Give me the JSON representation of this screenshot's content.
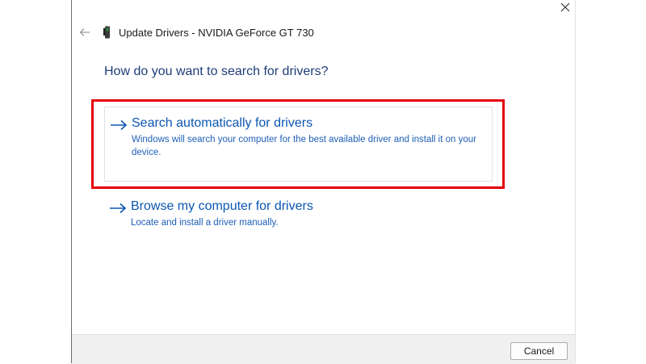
{
  "window": {
    "title": "Update Drivers - NVIDIA GeForce GT 730",
    "icons": {
      "close": "close-icon",
      "back": "arrow-left-icon",
      "device": "display-adapter-icon"
    }
  },
  "heading": "How do you want to search for drivers?",
  "options": [
    {
      "title": "Search automatically for drivers",
      "description": "Windows will search your computer for the best available driver and install it on your device.",
      "icon": "arrow-right-icon",
      "highlighted": true
    },
    {
      "title": "Browse my computer for drivers",
      "description": "Locate and install a driver manually.",
      "icon": "arrow-right-icon",
      "highlighted": false
    }
  ],
  "footer": {
    "cancel_label": "Cancel"
  },
  "colors": {
    "heading": "#1f3d7a",
    "link": "#0b56b3",
    "link_description": "#1f5fb8",
    "highlight_border": "#e3000b",
    "footer_bg": "#f0f0f0"
  }
}
